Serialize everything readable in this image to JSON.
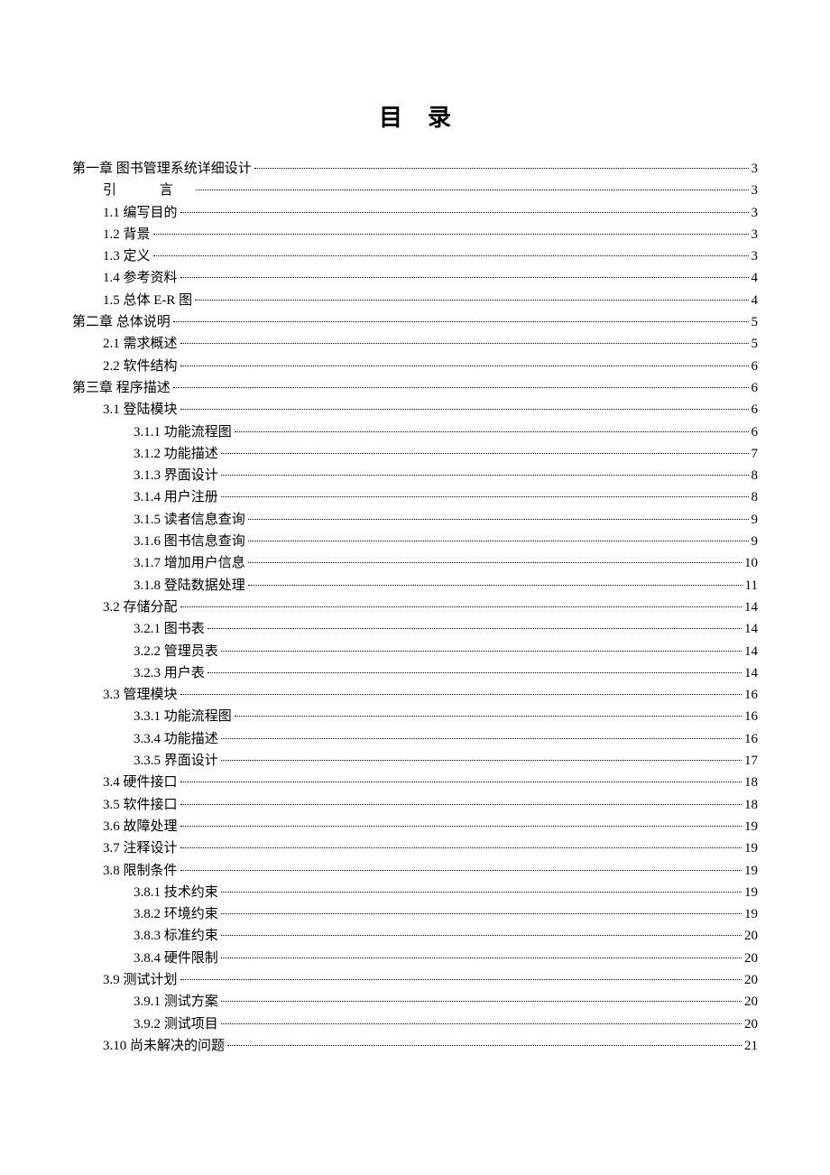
{
  "title": "目录",
  "toc": [
    {
      "level": 0,
      "label": "第一章 图书管理系统详细设计",
      "page": "3"
    },
    {
      "level": 1,
      "label": "引    言",
      "page": "3",
      "cls": "intro-label"
    },
    {
      "level": 1,
      "label": "1.1 编写目的",
      "page": "3"
    },
    {
      "level": 1,
      "label": "1.2 背景",
      "page": "3"
    },
    {
      "level": 1,
      "label": "1.3 定义",
      "page": "3"
    },
    {
      "level": 1,
      "label": "1.4 参考资料",
      "page": "4"
    },
    {
      "level": 1,
      "label": "1.5 总体 E-R 图",
      "page": "4"
    },
    {
      "level": 0,
      "label": "第二章 总体说明",
      "page": "5"
    },
    {
      "level": 1,
      "label": "2.1 需求概述",
      "page": "5"
    },
    {
      "level": 1,
      "label": "2.2 软件结构",
      "page": "6"
    },
    {
      "level": 0,
      "label": "第三章 程序描述",
      "page": "6"
    },
    {
      "level": 1,
      "label": "3.1 登陆模块",
      "page": "6"
    },
    {
      "level": 2,
      "label": "3.1.1 功能流程图",
      "page": "6"
    },
    {
      "level": 2,
      "label": "3.1.2 功能描述",
      "page": "7"
    },
    {
      "level": 2,
      "label": "3.1.3 界面设计",
      "page": "8"
    },
    {
      "level": 2,
      "label": "3.1.4 用户注册",
      "page": "8"
    },
    {
      "level": 2,
      "label": "3.1.5 读者信息查询",
      "page": "9"
    },
    {
      "level": 2,
      "label": "3.1.6 图书信息查询",
      "page": "9"
    },
    {
      "level": 2,
      "label": "3.1.7 增加用户信息",
      "page": "10"
    },
    {
      "level": 2,
      "label": "3.1.8 登陆数据处理",
      "page": "11"
    },
    {
      "level": 1,
      "label": "3.2 存储分配",
      "page": "14"
    },
    {
      "level": 2,
      "label": "3.2.1 图书表",
      "page": "14"
    },
    {
      "level": 2,
      "label": "3.2.2 管理员表",
      "page": "14"
    },
    {
      "level": 2,
      "label": "3.2.3 用户表",
      "page": "14"
    },
    {
      "level": 1,
      "label": "3.3 管理模块",
      "page": "16"
    },
    {
      "level": 2,
      "label": "3.3.1 功能流程图",
      "page": "16"
    },
    {
      "level": 2,
      "label": "3.3.4 功能描述",
      "page": "16"
    },
    {
      "level": 2,
      "label": "3.3.5 界面设计",
      "page": "17"
    },
    {
      "level": 1,
      "label": "3.4 硬件接口",
      "page": "18"
    },
    {
      "level": 1,
      "label": "3.5 软件接口",
      "page": "18"
    },
    {
      "level": 1,
      "label": "3.6 故障处理",
      "page": "19"
    },
    {
      "level": 1,
      "label": "3.7 注释设计",
      "page": "19"
    },
    {
      "level": 1,
      "label": "3.8 限制条件",
      "page": "19"
    },
    {
      "level": 2,
      "label": "3.8.1 技术约束",
      "page": "19"
    },
    {
      "level": 2,
      "label": "3.8.2 环境约束",
      "page": "19"
    },
    {
      "level": 2,
      "label": "3.8.3 标准约束",
      "page": "20"
    },
    {
      "level": 2,
      "label": "3.8.4 硬件限制",
      "page": "20"
    },
    {
      "level": 1,
      "label": "3.9 测试计划",
      "page": "20"
    },
    {
      "level": 2,
      "label": "3.9.1 测试方案",
      "page": "20"
    },
    {
      "level": 2,
      "label": "3.9.2 测试项目",
      "page": "20"
    },
    {
      "level": 1,
      "label": "3.10 尚未解决的问题",
      "page": "21"
    }
  ]
}
